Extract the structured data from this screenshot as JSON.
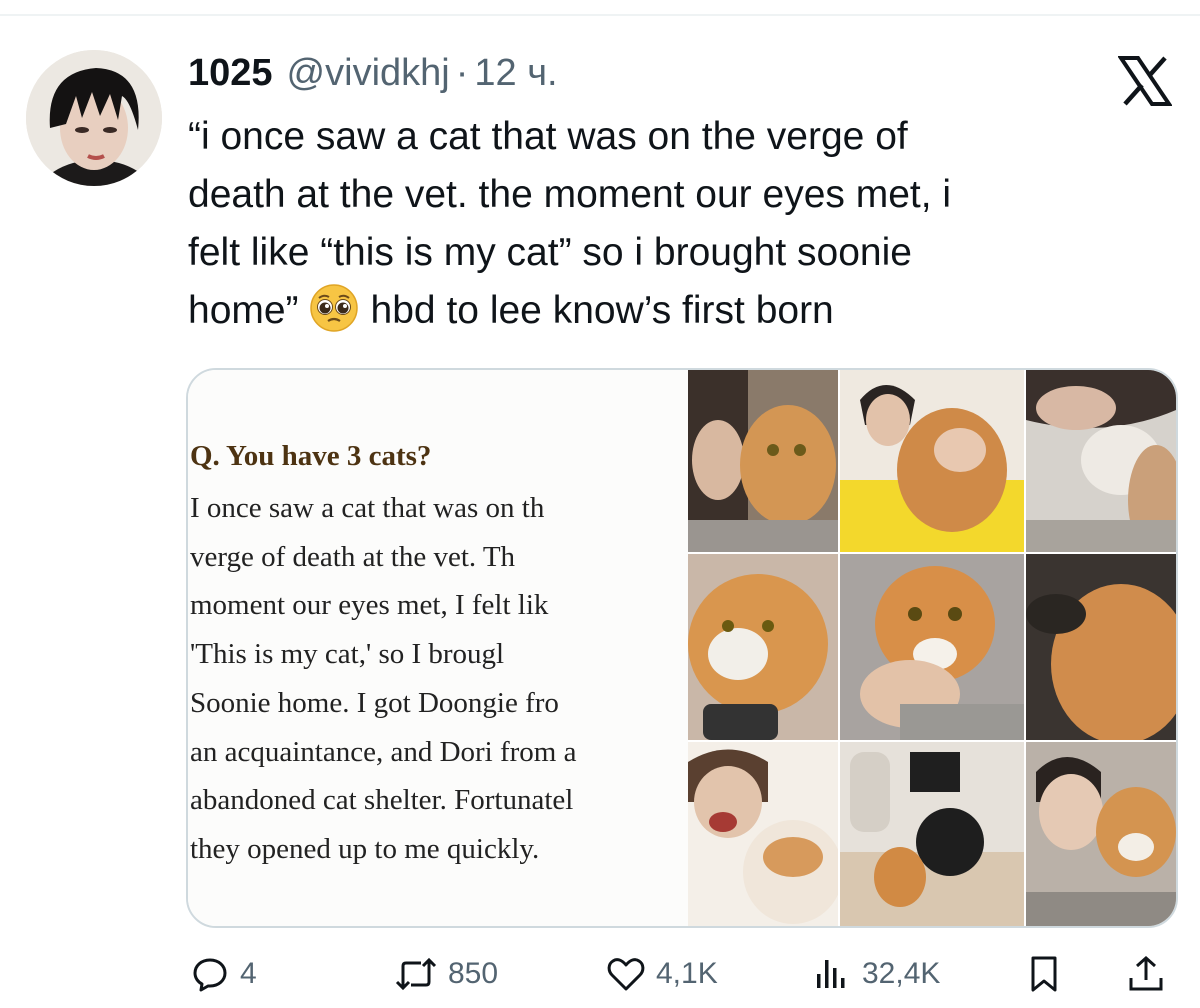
{
  "tweet": {
    "display_name": "1025",
    "handle": "@vividkhj",
    "separator": "·",
    "time": "12 ч.",
    "text_lines": [
      "“i once saw a cat that was on the verge of",
      "death at the vet. the moment our eyes met, i",
      "felt like “this is my cat” so i brought soonie",
      "home”"
    ],
    "text_after_emoji": "hbd to lee know’s first born",
    "emoji_icon": "pleading-face-emoji"
  },
  "media": {
    "question": "Q.  You have 3 cats?",
    "answer_lines": [
      "I  once  saw  a  cat  that  was  on  th",
      "verge  of  death  at  the  vet.  Th",
      "moment our eyes met,    I felt lik",
      "'This  is  my  cat,'  so  I  brougl",
      "Soonie home. I got Doongie fro",
      "an acquaintance, and Dori from a",
      "abandoned cat shelter. Fortunatel",
      "they opened up to me quickly."
    ]
  },
  "actions": {
    "replies": "4",
    "retweets": "850",
    "likes": "4,1K",
    "views": "32,4K"
  },
  "colors": {
    "text": "#0f1419",
    "secondary": "#536471",
    "border": "#cfd9de",
    "doc_heading": "#4d3312"
  }
}
